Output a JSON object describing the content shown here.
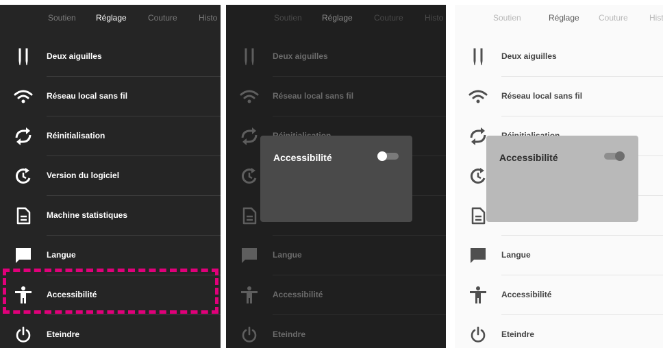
{
  "tabs": [
    "Soutien",
    "Réglage",
    "Couture",
    "Histo"
  ],
  "active_tab": "Réglage",
  "menu_items": [
    {
      "label": "Deux aiguilles",
      "icon": "twin-needle-icon"
    },
    {
      "label": "Réseau local sans fil",
      "icon": "wifi-icon"
    },
    {
      "label": "Réinitialisation",
      "icon": "reset-icon"
    },
    {
      "label": "Version du logiciel",
      "icon": "software-version-icon"
    },
    {
      "label": "Machine statistiques",
      "icon": "document-icon"
    },
    {
      "label": "Langue",
      "icon": "speech-bubble-icon"
    },
    {
      "label": "Accessibilité",
      "icon": "accessibility-icon"
    },
    {
      "label": "Eteindre",
      "icon": "power-icon"
    }
  ],
  "dialog": {
    "title": "Accessibilité",
    "toggle_states": [
      "off",
      "on"
    ]
  },
  "colors": {
    "highlight": "#e0007a",
    "dark_bg": "#252525",
    "light_bg": "#fafafa"
  }
}
